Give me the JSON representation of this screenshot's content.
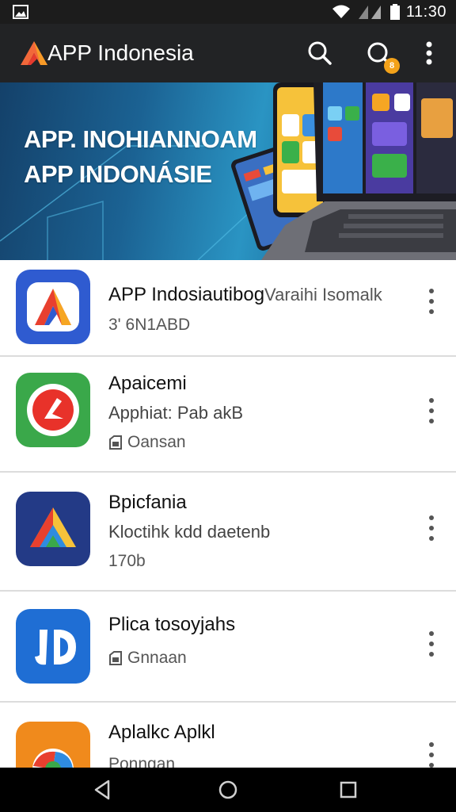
{
  "status_bar": {
    "time": "11:30"
  },
  "app_bar": {
    "title": "APP Indonesia",
    "notification_count": "8"
  },
  "banner": {
    "line1": "APP. INOHIANNOAM",
    "line2": "APP INDONÁSIE"
  },
  "apps": [
    {
      "name": "APP Indosiautibog",
      "name_extra": "Varaihi Isomalk",
      "meta": "3' 6N1ABD"
    },
    {
      "name": "Apaicemi",
      "subtitle": "Apphiat: Pab akB",
      "meta": "Oansan"
    },
    {
      "name": "Bpicfania",
      "subtitle": "Kloctihk kdd daetenb",
      "meta": "170b"
    },
    {
      "name": "Plica tosoyjahs",
      "meta": "Gnnaan"
    },
    {
      "name": "Aplalkc Aplkl",
      "meta": "Ponngan"
    }
  ],
  "colors": {
    "app_bar": "#222325",
    "accent_badge": "#f3a21a",
    "nav_bar": "#000000"
  }
}
